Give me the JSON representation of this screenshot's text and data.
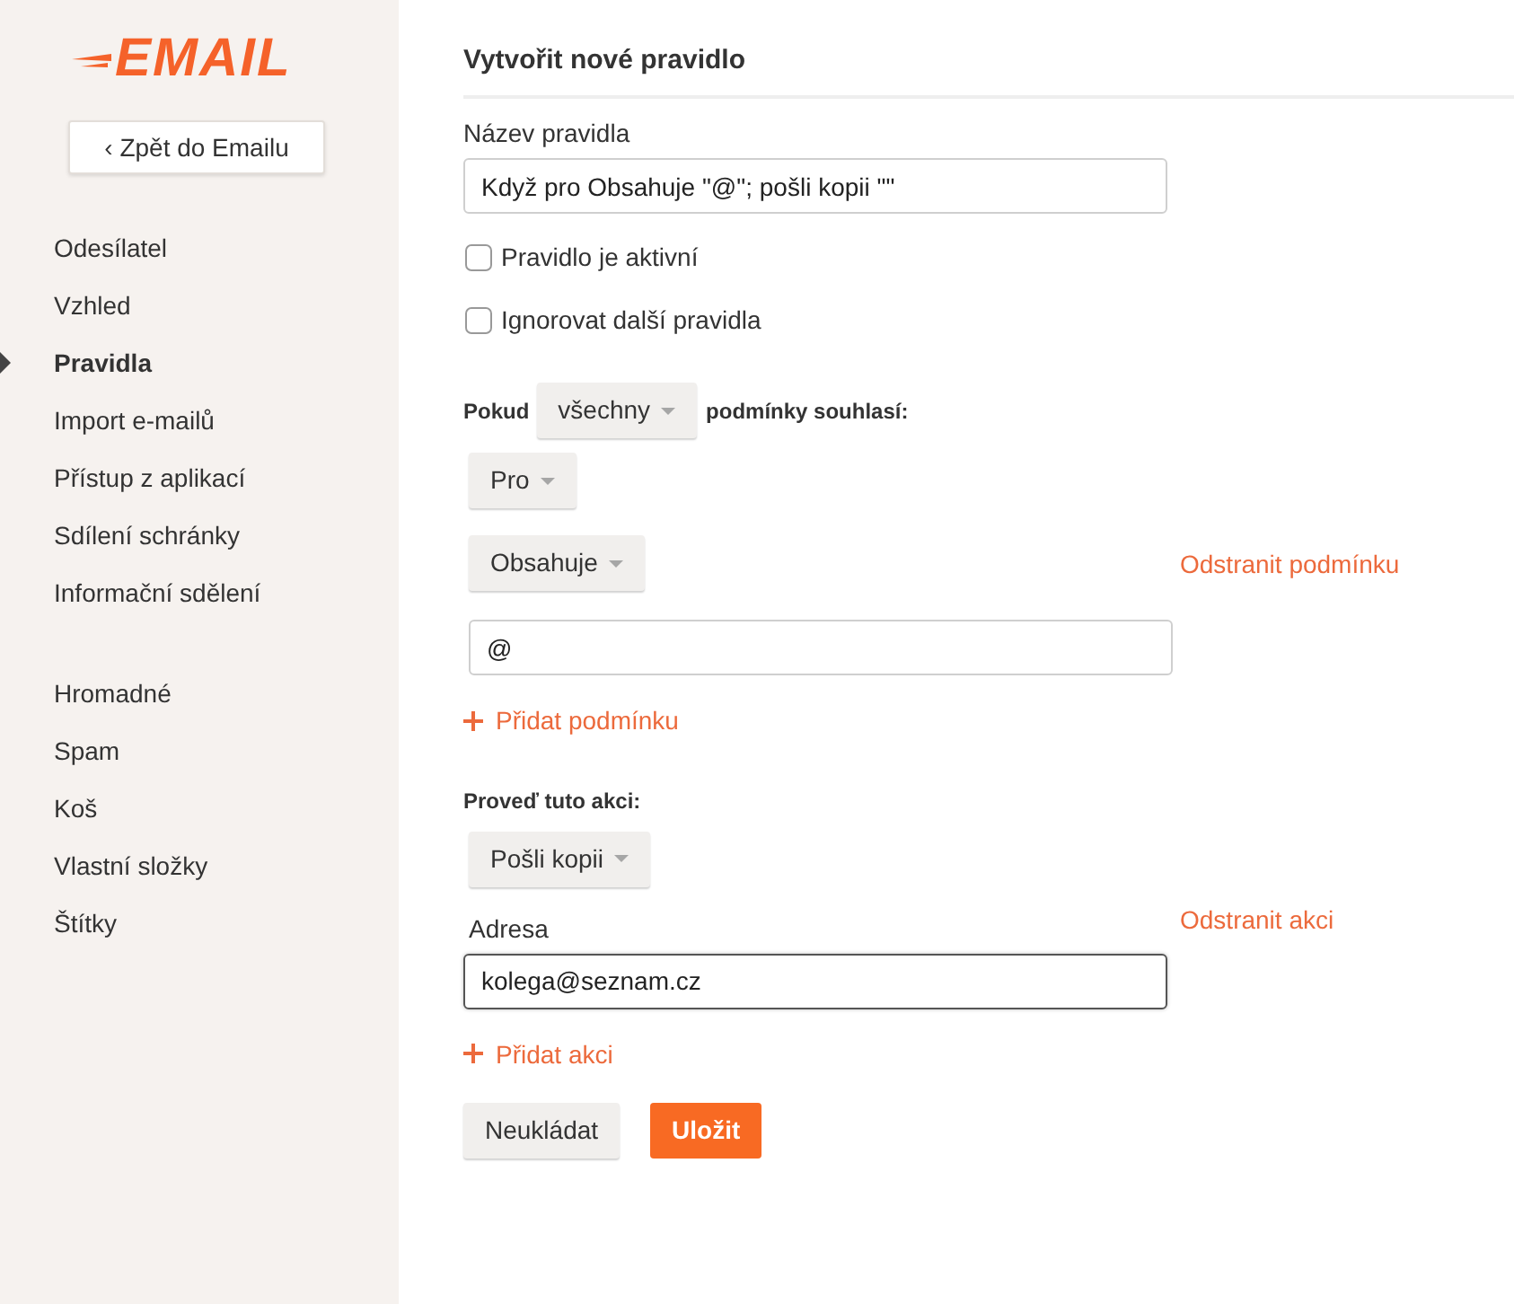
{
  "logo": {
    "text": "EMAIL"
  },
  "back_button": {
    "label": "‹ Zpět do Emailu"
  },
  "sidebar": {
    "groups": [
      {
        "items": [
          {
            "label": "Odesílatel",
            "selected": false
          },
          {
            "label": "Vzhled",
            "selected": false
          },
          {
            "label": "Pravidla",
            "selected": true
          },
          {
            "label": "Import e-mailů",
            "selected": false
          },
          {
            "label": "Přístup z aplikací",
            "selected": false
          },
          {
            "label": "Sdílení schránky",
            "selected": false
          },
          {
            "label": "Informační sdělení",
            "selected": false
          }
        ]
      },
      {
        "items": [
          {
            "label": "Hromadné",
            "selected": false
          },
          {
            "label": "Spam",
            "selected": false
          },
          {
            "label": "Koš",
            "selected": false
          },
          {
            "label": "Vlastní složky",
            "selected": false
          },
          {
            "label": "Štítky",
            "selected": false
          }
        ]
      }
    ]
  },
  "form": {
    "title": "Vytvořit nové pravidlo",
    "name_label": "Název pravidla",
    "name_value": "Když pro Obsahuje \"@\"; pošli kopii \"\"",
    "options": [
      {
        "label": "Pravidlo je aktivní",
        "checked": false
      },
      {
        "label": "Ignorovat další pravidla",
        "checked": false
      }
    ],
    "conditions": {
      "prefix": "Pokud",
      "match": "všechny",
      "suffix": "podmínky souhlasí:",
      "items": [
        {
          "field": "Pro",
          "operator": "Obsahuje",
          "remove": "Odstranit podmínku",
          "value": "@",
          "focused": false
        }
      ],
      "add": "Přidat podmínku"
    },
    "actions": {
      "title": "Proveď tuto akci:",
      "items": [
        {
          "action": "Pošli kopii",
          "field_label": "Adresa",
          "remove": "Odstranit akci",
          "value": "kolega@seznam.cz",
          "focused": true
        }
      ],
      "add": "Přidat akci"
    },
    "buttons": [
      {
        "label": "Neukládat",
        "kind": "secondary"
      },
      {
        "label": "Uložit",
        "kind": "primary"
      }
    ]
  }
}
